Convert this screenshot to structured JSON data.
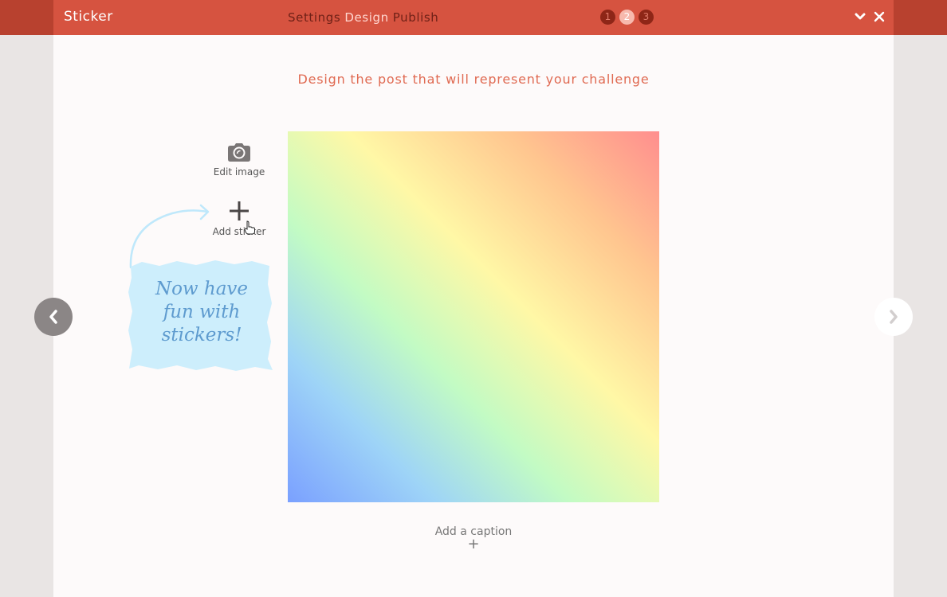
{
  "header": {
    "app_title": "Sticker",
    "steps": [
      {
        "label": "Settings",
        "active": false
      },
      {
        "label": "Design",
        "active": true
      },
      {
        "label": "Publish",
        "active": false
      }
    ],
    "step_numbers": [
      "1",
      "2",
      "3"
    ],
    "active_step": 2,
    "icons": [
      "chevron-down-icon",
      "close-icon"
    ]
  },
  "main": {
    "heading": "Design the post that will represent your challenge",
    "tools": [
      {
        "label": "Edit image",
        "icon": "camera-icon"
      },
      {
        "label": "Add sticker",
        "icon": "plus-icon"
      }
    ],
    "sticker_note": {
      "lines": [
        "Now have",
        "fun with",
        "stickers!"
      ]
    },
    "caption": {
      "label": "Add a caption",
      "icon": "plus-icon"
    }
  },
  "colors": {
    "header_bg": "#d65340",
    "header_edge": "#b8412f",
    "accent_text": "#e06a52",
    "note_bg": "#cdeefc",
    "note_text": "#5e9bcf"
  }
}
